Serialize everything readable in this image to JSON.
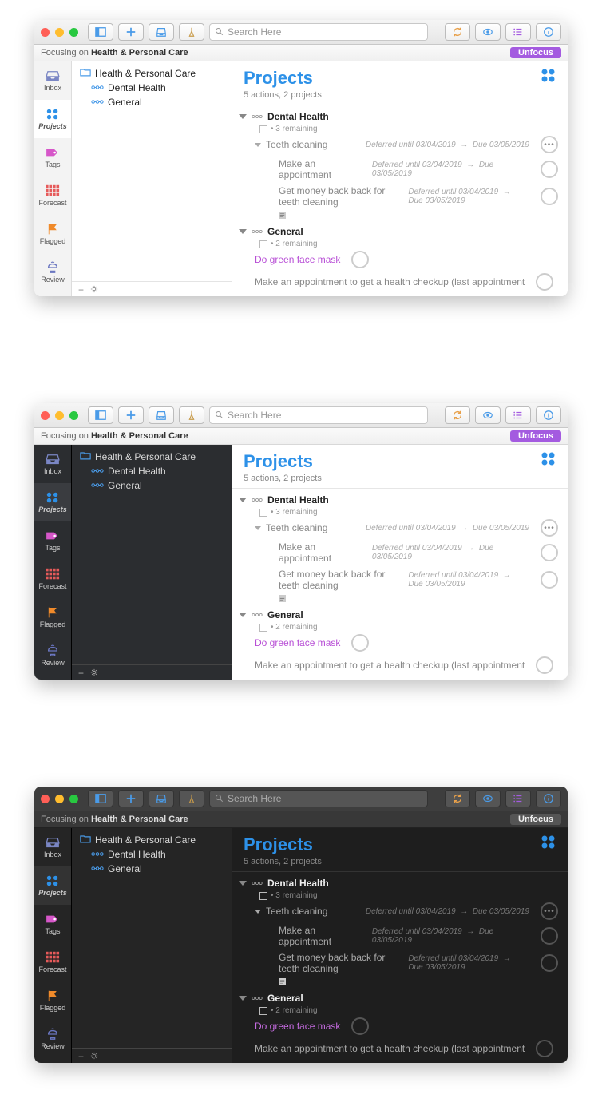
{
  "search_placeholder": "Search Here",
  "focus": {
    "prefix": "Focusing on ",
    "name": "Health & Personal Care",
    "unfocus": "Unfocus"
  },
  "tabs": [
    {
      "label": "Inbox",
      "icon": "inbox",
      "color": "#7a86c4"
    },
    {
      "label": "Projects",
      "icon": "projects",
      "color": "#2d91e8",
      "active": true
    },
    {
      "label": "Tags",
      "icon": "tag",
      "color": "#d657c9"
    },
    {
      "label": "Forecast",
      "icon": "forecast",
      "color": "#e65a5a"
    },
    {
      "label": "Flagged",
      "icon": "flag",
      "color": "#f08a2a"
    },
    {
      "label": "Review",
      "icon": "review",
      "color": "#6a76c0"
    }
  ],
  "sidebar": {
    "root": "Health & Personal Care",
    "items": [
      "Dental Health",
      "General"
    ]
  },
  "main": {
    "title": "Projects",
    "subtitle": "5 actions, 2 projects"
  },
  "projects": [
    {
      "name": "Dental Health",
      "remaining": "3 remaining",
      "groups": [
        {
          "name": "Teeth cleaning",
          "defer": "Deferred until 03/04/2019",
          "due": "Due 03/05/2019",
          "actions": [
            {
              "name": "Make an appointment",
              "defer": "Deferred until 03/04/2019",
              "due": "Due 03/05/2019"
            },
            {
              "name": "Get money back back for teeth cleaning",
              "defer": "Deferred until 03/04/2019",
              "due": "Due 03/05/2019",
              "note": true
            }
          ]
        }
      ]
    },
    {
      "name": "General",
      "remaining": "2 remaining",
      "actions": [
        {
          "name": "Do green face mask",
          "flagged": true
        },
        {
          "name": "Make an appointment to get a health checkup (last appointment"
        }
      ]
    }
  ]
}
